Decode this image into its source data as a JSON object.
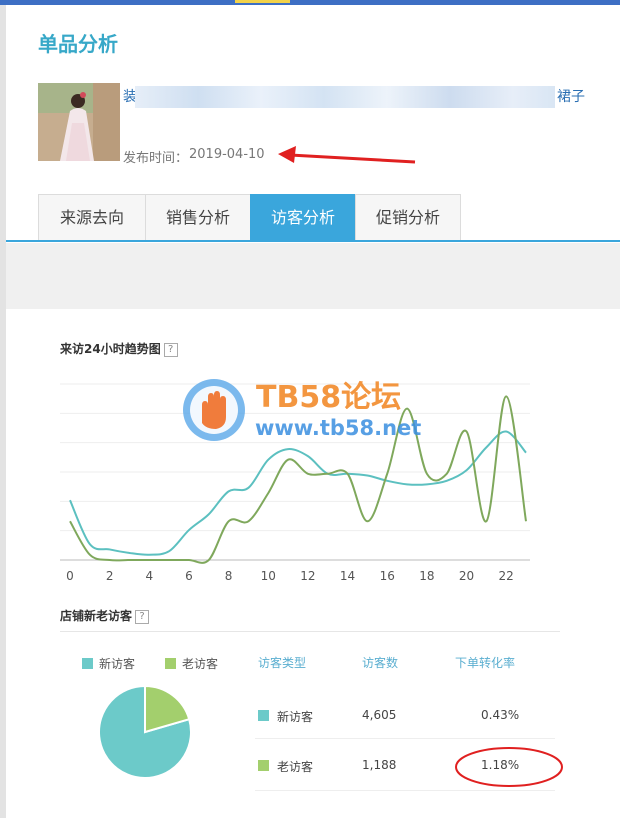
{
  "page": {
    "title": "单品分析"
  },
  "product": {
    "title_start": "装",
    "title_end": "裙子",
    "publish_label": "发布时间：",
    "publish_date": "2019-04-10"
  },
  "tabs": [
    {
      "label": "来源去向",
      "active": false
    },
    {
      "label": "销售分析",
      "active": false
    },
    {
      "label": "访客分析",
      "active": true
    },
    {
      "label": "促销分析",
      "active": false
    }
  ],
  "trend_section": {
    "title": "来访24小时趋势图",
    "help": "?"
  },
  "watermark": {
    "line1": "TB58论坛",
    "line2": "www.tb58.net"
  },
  "chart_data": [
    {
      "type": "line",
      "title": "来访24小时趋势图",
      "x": [
        0,
        1,
        2,
        3,
        4,
        5,
        6,
        7,
        8,
        9,
        10,
        11,
        12,
        13,
        14,
        15,
        16,
        17,
        18,
        19,
        20,
        21,
        22,
        23
      ],
      "x_tick_labels": [
        "0",
        "2",
        "4",
        "6",
        "8",
        "10",
        "12",
        "14",
        "16",
        "18",
        "20",
        "22"
      ],
      "ylim": [
        0,
        100
      ],
      "grid": true,
      "series": [
        {
          "color": "#5cc0c0",
          "values": [
            34,
            9,
            6,
            4,
            3,
            5,
            17,
            26,
            39,
            41,
            57,
            63,
            59,
            49,
            49,
            48,
            45,
            43,
            43,
            45,
            51,
            64,
            73,
            61
          ]
        },
        {
          "color": "#7fa85c",
          "values": [
            22,
            3,
            0,
            0,
            0,
            0,
            0,
            0,
            22,
            22,
            38,
            57,
            49,
            49,
            49,
            22,
            49,
            86,
            49,
            49,
            73,
            22,
            93,
            22
          ]
        }
      ]
    },
    {
      "type": "pie",
      "title": "店铺新老访客",
      "categories": [
        "新访客",
        "老访客"
      ],
      "values": [
        4605,
        1188
      ],
      "colors": [
        "#6ccac9",
        "#a3cf6d"
      ]
    }
  ],
  "visitors_section": {
    "title": "店铺新老访客",
    "help": "?",
    "legend": [
      {
        "label": "新访客",
        "color": "#6ccac9"
      },
      {
        "label": "老访客",
        "color": "#a3cf6d"
      }
    ],
    "table": {
      "headers": [
        "访客类型",
        "访客数",
        "下单转化率"
      ],
      "rows": [
        {
          "type": "新访客",
          "count": "4,605",
          "rate": "0.43%",
          "color": "#6ccac9"
        },
        {
          "type": "老访客",
          "count": "1,188",
          "rate": "1.18%",
          "color": "#a3cf6d"
        }
      ]
    }
  },
  "colors": {
    "accent": "#3aa6dc",
    "title": "#37a8c8",
    "annotation": "#e02020"
  }
}
